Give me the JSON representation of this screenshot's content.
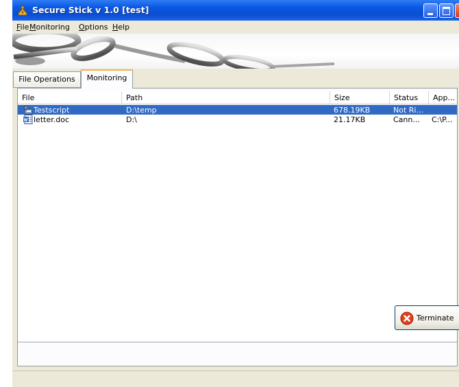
{
  "window": {
    "title": "Secure Stick v 1.0  [test]"
  },
  "menu": [
    {
      "label": "File"
    },
    {
      "label": "Monitoring"
    },
    {
      "label": "Options"
    },
    {
      "label": "Help"
    }
  ],
  "tabs": [
    {
      "label": "File Operations",
      "active": false
    },
    {
      "label": "Monitoring",
      "active": true
    }
  ],
  "table": {
    "columns": [
      "File",
      "Path",
      "Size",
      "Status",
      "App..."
    ],
    "rows": [
      {
        "file": "Testscript",
        "path": "D:\\temp",
        "size": "678.19KB",
        "status": "Not Ri...",
        "app": "",
        "icon": "script-icon",
        "selected": true
      },
      {
        "file": "letter.doc",
        "path": "D:\\",
        "size": "21.17KB",
        "status": "Cann...",
        "app": "C:\\P...",
        "icon": "word-document-icon",
        "selected": false
      }
    ]
  },
  "actions": {
    "terminate_label": "Terminate"
  },
  "colors": {
    "titlebar": "#0b58e3",
    "selection": "#316ac5",
    "terminate_icon": "#e0401e"
  }
}
